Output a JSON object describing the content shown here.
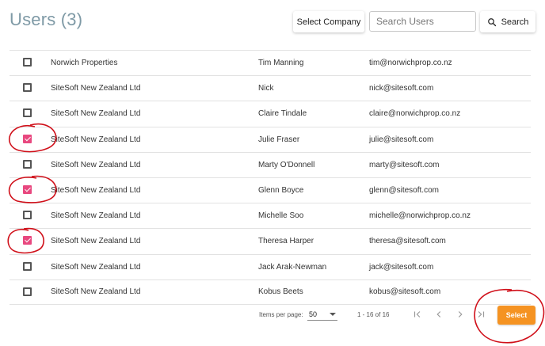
{
  "header": {
    "title": "Users (3)",
    "select_company_label": "Select Company",
    "search_placeholder": "Search Users",
    "search_button_label": "Search"
  },
  "rows": [
    {
      "company": "Norwich Properties",
      "name": "Tim Manning",
      "email": "tim@norwichprop.co.nz",
      "checked": false
    },
    {
      "company": "SiteSoft New Zealand Ltd",
      "name": "Nick",
      "email": "nick@sitesoft.com",
      "checked": false
    },
    {
      "company": "SiteSoft New Zealand Ltd",
      "name": "Claire Tindale",
      "email": "claire@norwichprop.co.nz",
      "checked": false
    },
    {
      "company": "SiteSoft New Zealand Ltd",
      "name": "Julie Fraser",
      "email": "julie@sitesoft.com",
      "checked": true
    },
    {
      "company": "SiteSoft New Zealand Ltd",
      "name": "Marty O'Donnell",
      "email": "marty@sitesoft.com",
      "checked": false
    },
    {
      "company": "SiteSoft New Zealand Ltd",
      "name": "Glenn Boyce",
      "email": "glenn@sitesoft.com",
      "checked": true
    },
    {
      "company": "SiteSoft New Zealand Ltd",
      "name": "Michelle Soo",
      "email": "michelle@norwichprop.co.nz",
      "checked": false
    },
    {
      "company": "SiteSoft New Zealand Ltd",
      "name": "Theresa Harper",
      "email": "theresa@sitesoft.com",
      "checked": true
    },
    {
      "company": "SiteSoft New Zealand Ltd",
      "name": "Jack Arak-Newman",
      "email": "jack@sitesoft.com",
      "checked": false
    },
    {
      "company": "SiteSoft New Zealand Ltd",
      "name": "Kobus Beets",
      "email": "kobus@sitesoft.com",
      "checked": false
    }
  ],
  "paginator": {
    "items_per_page_label": "Items per page:",
    "page_size": "50",
    "range_label": "1 - 16 of 16"
  },
  "footer": {
    "select_button_label": "Select"
  },
  "colors": {
    "title": "#7f9aa6",
    "checkbox_checked": "#e8487f",
    "select_button": "#f59322",
    "annotation": "#d0101a"
  },
  "icons": [
    "search-icon",
    "first-page-icon",
    "previous-page-icon",
    "next-page-icon",
    "last-page-icon"
  ]
}
